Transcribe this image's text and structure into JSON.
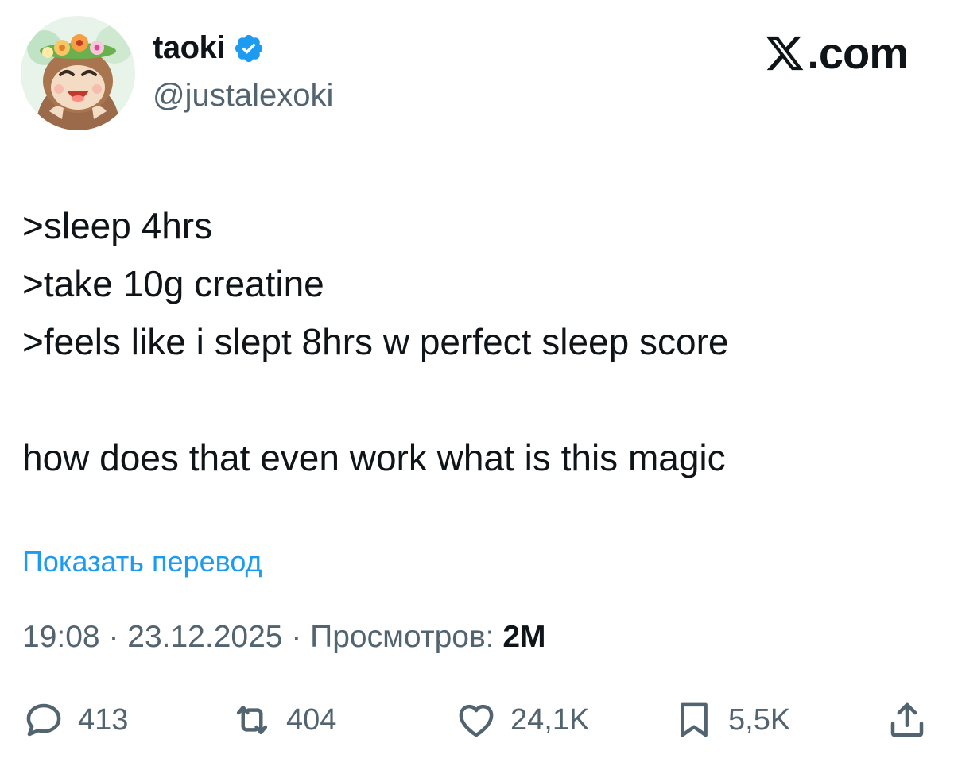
{
  "header": {
    "display_name": "taoki",
    "handle": "@justalexoki",
    "brand": ".com",
    "verified_icon": "verified-badge-icon",
    "colors": {
      "verified": "#1d9bf0",
      "link": "#1d9bf0",
      "secondary": "#536471",
      "text": "#0f1419"
    }
  },
  "tweet": {
    "text": ">sleep 4hrs\n>take 10g creatine\n>feels like i slept 8hrs w perfect sleep score\n\nhow does that even work what is this magic",
    "translate_link": "Показать перевод"
  },
  "meta": {
    "time": "19:08",
    "separator": " · ",
    "date": "23.12.2025",
    "views_label": "Просмотров: ",
    "views_count": "2M"
  },
  "actions": {
    "replies": {
      "count": "413",
      "icon": "reply-icon"
    },
    "reposts": {
      "count": "404",
      "icon": "repost-icon"
    },
    "likes": {
      "count": "24,1K",
      "icon": "heart-icon"
    },
    "bookmarks": {
      "count": "5,5K",
      "icon": "bookmark-icon"
    },
    "share": {
      "icon": "share-icon"
    }
  }
}
